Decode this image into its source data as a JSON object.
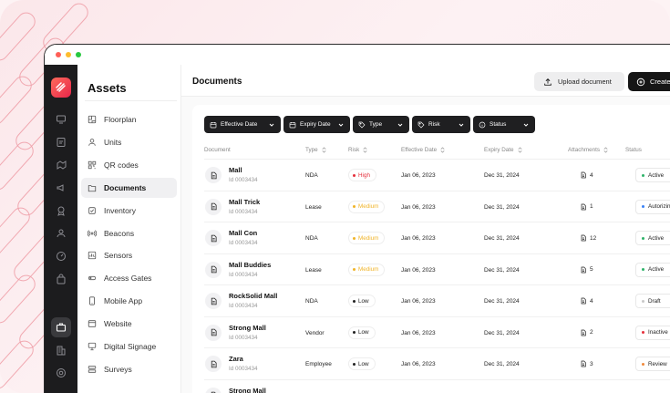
{
  "app": {
    "section_title": "Assets",
    "page_title": "Documents"
  },
  "header": {
    "upload_label": "Upload document",
    "create_label": "Create"
  },
  "sidebar": {
    "items": [
      {
        "label": "Floorplan",
        "icon": "floorplan-icon"
      },
      {
        "label": "Units",
        "icon": "units-icon"
      },
      {
        "label": "QR codes",
        "icon": "qr-icon"
      },
      {
        "label": "Documents",
        "icon": "folder-icon",
        "active": true
      },
      {
        "label": "Inventory",
        "icon": "inventory-icon"
      },
      {
        "label": "Beacons",
        "icon": "beacon-icon"
      },
      {
        "label": "Sensors",
        "icon": "sensor-icon"
      },
      {
        "label": "Access Gates",
        "icon": "gate-icon"
      },
      {
        "label": "Mobile App",
        "icon": "mobile-icon"
      },
      {
        "label": "Website",
        "icon": "website-icon"
      },
      {
        "label": "Digital Signage",
        "icon": "signage-icon"
      },
      {
        "label": "Surveys",
        "icon": "survey-icon"
      }
    ]
  },
  "filters": [
    {
      "label": "Effective Date",
      "icon": "calendar-icon"
    },
    {
      "label": "Expiry Date",
      "icon": "calendar-icon"
    },
    {
      "label": "Type",
      "icon": "tag-icon"
    },
    {
      "label": "Risk",
      "icon": "tag-icon"
    },
    {
      "label": "Status",
      "icon": "info-icon"
    }
  ],
  "columns": {
    "document": "Document",
    "type": "Type",
    "risk": "Risk",
    "effective": "Effective Date",
    "expiry": "Expiry Date",
    "attachments": "Attachments",
    "status": "Status"
  },
  "rows": [
    {
      "name": "Mall",
      "id": "Id 0003434",
      "type": "NDA",
      "risk": "High",
      "effective": "Jan 06, 2023",
      "expiry": "Dec 31, 2024",
      "attachments": "4",
      "status": "Active"
    },
    {
      "name": "Mall Trick",
      "id": "Id 0003434",
      "type": "Lease",
      "risk": "Medium",
      "effective": "Jan 06, 2023",
      "expiry": "Dec 31, 2024",
      "attachments": "1",
      "status": "Autorizing"
    },
    {
      "name": "Mall Con",
      "id": "Id 0003434",
      "type": "NDA",
      "risk": "Medium",
      "effective": "Jan 06, 2023",
      "expiry": "Dec 31, 2024",
      "attachments": "12",
      "status": "Active"
    },
    {
      "name": "Mall Buddies",
      "id": "Id 0003434",
      "type": "Lease",
      "risk": "Medium",
      "effective": "Jan 06, 2023",
      "expiry": "Dec 31, 2024",
      "attachments": "5",
      "status": "Active"
    },
    {
      "name": "RockSolid Mall",
      "id": "Id 0003434",
      "type": "NDA",
      "risk": "Low",
      "effective": "Jan 06, 2023",
      "expiry": "Dec 31, 2024",
      "attachments": "4",
      "status": "Draft"
    },
    {
      "name": "Strong Mall",
      "id": "Id 0003434",
      "type": "Vendor",
      "risk": "Low",
      "effective": "Jan 06, 2023",
      "expiry": "Dec 31, 2024",
      "attachments": "2",
      "status": "Inactive"
    },
    {
      "name": "Zara",
      "id": "Id 0003434",
      "type": "Employee",
      "risk": "Low",
      "effective": "Jan 06, 2023",
      "expiry": "Dec 31, 2024",
      "attachments": "3",
      "status": "Review"
    },
    {
      "name": "Strong Mall",
      "id": "",
      "type": "",
      "risk": "",
      "effective": "",
      "expiry": "",
      "attachments": "",
      "status": ""
    }
  ],
  "colors": {
    "accent": "#e7264a",
    "risk_high": "#e5303c",
    "risk_medium": "#f0b429",
    "risk_low": "#222222",
    "status_active": "#2fb36a",
    "status_autorizing": "#3b82f6",
    "status_draft": "#c8c8c8",
    "status_inactive": "#e5303c",
    "status_review": "#f08a3c"
  }
}
